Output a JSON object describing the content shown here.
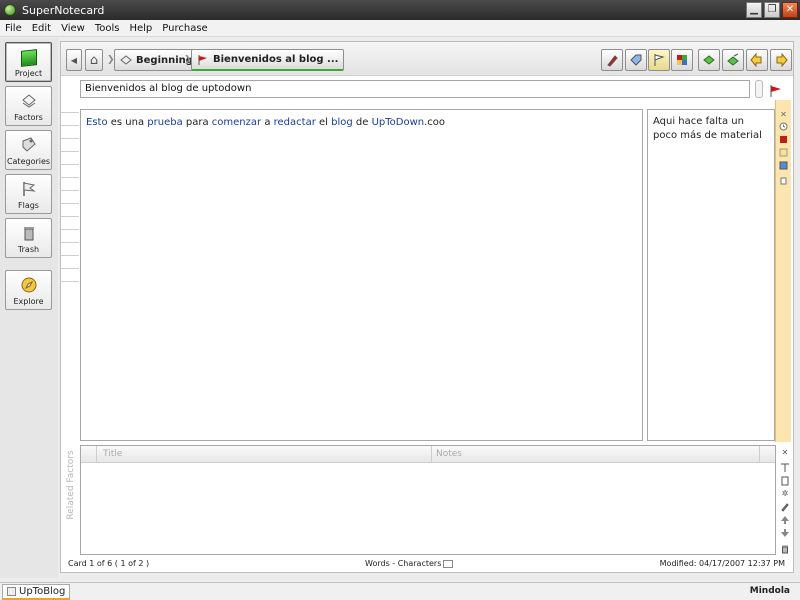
{
  "window": {
    "title": "SuperNotecard",
    "minimize": "▁",
    "restore": "❐",
    "close": "✕"
  },
  "menu": [
    "File",
    "Edit",
    "View",
    "Tools",
    "Help",
    "Purchase"
  ],
  "sidebar": {
    "items": [
      {
        "label": "Project",
        "icon": "project-icon"
      },
      {
        "label": "Factors",
        "icon": "factors-icon"
      },
      {
        "label": "Categories",
        "icon": "categories-icon"
      },
      {
        "label": "Flags",
        "icon": "flags-icon"
      },
      {
        "label": "Trash",
        "icon": "trash-icon"
      },
      {
        "label": "Explore",
        "icon": "explore-icon"
      }
    ]
  },
  "nav": {
    "back_glyph": "◀",
    "home_glyph": "⌂",
    "crumbs": [
      {
        "label": "Beginning"
      },
      {
        "label": "Bienvenidos al blog ..."
      }
    ],
    "crumb_sep": "❯"
  },
  "card": {
    "title": "Bienvenidos al blog de uptodown",
    "body": {
      "w1": "Esto",
      "t1": " es una ",
      "w2": "prueba",
      "t2": " para ",
      "w3": "comenzar",
      "t3": " a ",
      "w4": "redactar",
      "t4": " el ",
      "w5": "blog",
      "t5": " de ",
      "w6": "UpToDown",
      "t6": ".coo"
    },
    "notes": "Aqui hace falta un poco más de material"
  },
  "related": {
    "label": "Related Factors",
    "col_title": "Title",
    "col_notes": "Notes"
  },
  "footer": {
    "card_pos": "Card 1 of 6   ( 1 of 2 )",
    "words": "Words - Characters",
    "modified": "Modified: 04/17/2007 12:37 PM"
  },
  "status": {
    "tab": "UpToBlog",
    "right": "Mindola"
  },
  "colors": {
    "accent_green": "#3aaa35",
    "flag_red": "#c41a1a",
    "strip_yellow": "#fde5b0",
    "link_blue": "#1a3c9c"
  }
}
